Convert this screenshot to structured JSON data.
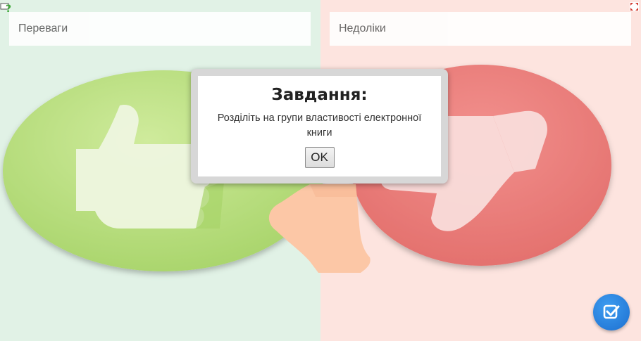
{
  "groups": {
    "pros_label": "Переваги",
    "cons_label": "Недоліки"
  },
  "dialog": {
    "title": "Завдання:",
    "message": "Розділіть на групи властивості електронної книги",
    "ok_label": "OK"
  },
  "colors": {
    "pros_background": "#e1f2e6",
    "cons_background": "#fde4df",
    "thumb_up_circle": "#b9df7f",
    "thumb_down_circle": "#ea7b78",
    "check_button": "#2a85e0"
  },
  "icons": {
    "help": "help-question-icon",
    "fullscreen": "fullscreen-icon",
    "check": "check-answer-icon",
    "thumb_up": "thumbs-up-icon",
    "thumb_down": "thumbs-down-icon",
    "hand": "hand-icon"
  }
}
